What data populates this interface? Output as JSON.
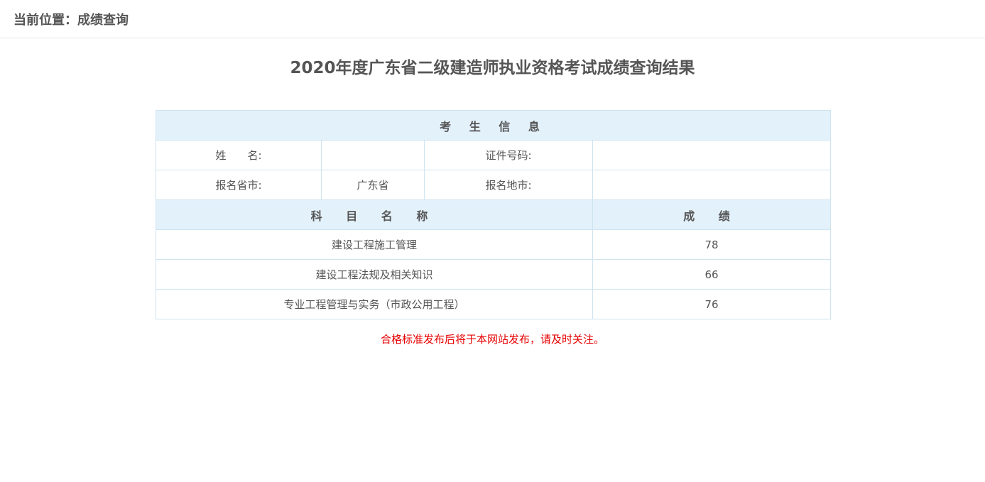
{
  "breadcrumb": "当前位置：成绩查询",
  "page_title": "2020年度广东省二级建造师执业资格考试成绩查询结果",
  "candidate_section": {
    "header": "考 生 信 息",
    "name_label": "姓　　名:",
    "name_value": "",
    "id_label": "证件号码:",
    "id_value": "",
    "province_label": "报名省市:",
    "province_value": "广东省",
    "city_label": "报名地市:",
    "city_value": ""
  },
  "scores_section": {
    "subject_header": "科 目 名 称",
    "score_header": "成 绩",
    "rows": [
      {
        "subject": "建设工程施工管理",
        "score": "78"
      },
      {
        "subject": "建设工程法规及相关知识",
        "score": "66"
      },
      {
        "subject": "专业工程管理与实务（市政公用工程）",
        "score": "76"
      }
    ]
  },
  "notice": "合格标准发布后将于本网站发布，请及时关注。",
  "colors": {
    "header_bg": "#e3f1fb",
    "border": "#cfe4ef",
    "notice": "#e60000",
    "text": "#555555"
  }
}
